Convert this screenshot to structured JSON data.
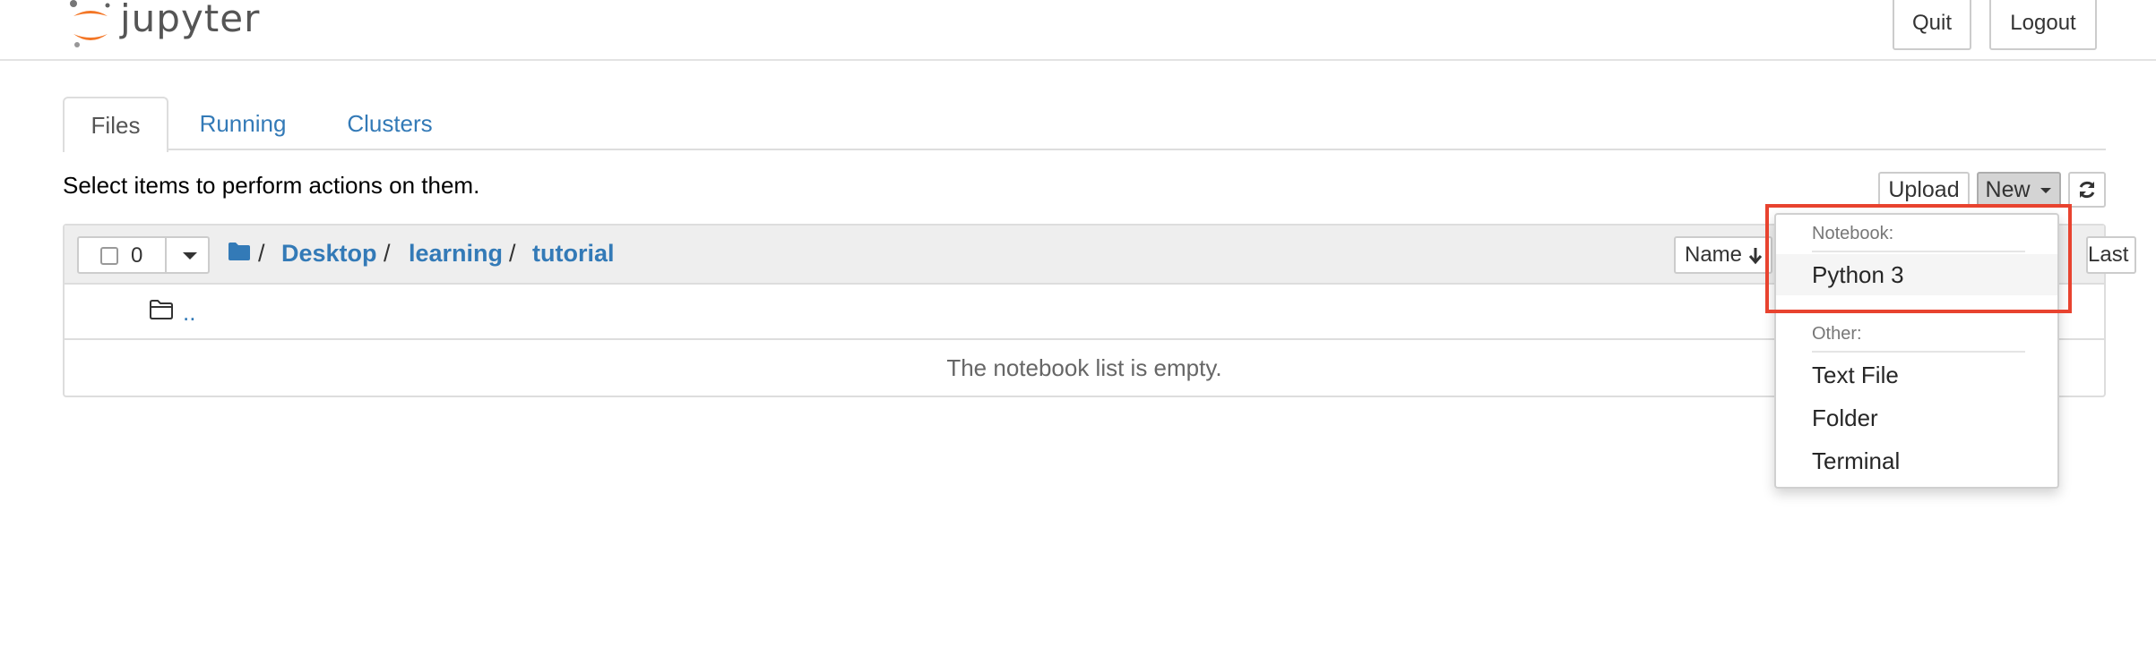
{
  "header": {
    "logo_text": "jupyter",
    "quit_label": "Quit",
    "logout_label": "Logout"
  },
  "tabs": [
    {
      "label": "Files"
    },
    {
      "label": "Running"
    },
    {
      "label": "Clusters"
    }
  ],
  "toolbar": {
    "select_info": "Select items to perform actions on them.",
    "upload_label": "Upload",
    "new_label": "New",
    "refresh_icon": "refresh-icon"
  },
  "file_list": {
    "selected_count": "0",
    "breadcrumb": [
      "Desktop",
      "learning",
      "tutorial"
    ],
    "sort_label": "Name",
    "size_label": "Last Modified  File size",
    "parent_label": "..",
    "empty_message": "The notebook list is empty."
  },
  "new_menu": {
    "notebook_header": "Notebook:",
    "notebook_items": [
      "Python 3"
    ],
    "other_header": "Other:",
    "other_items": [
      "Text File",
      "Folder",
      "Terminal"
    ]
  },
  "colors": {
    "link": "#337ab7",
    "highlight": "#e8432f",
    "logo_orange": "#f37626"
  }
}
